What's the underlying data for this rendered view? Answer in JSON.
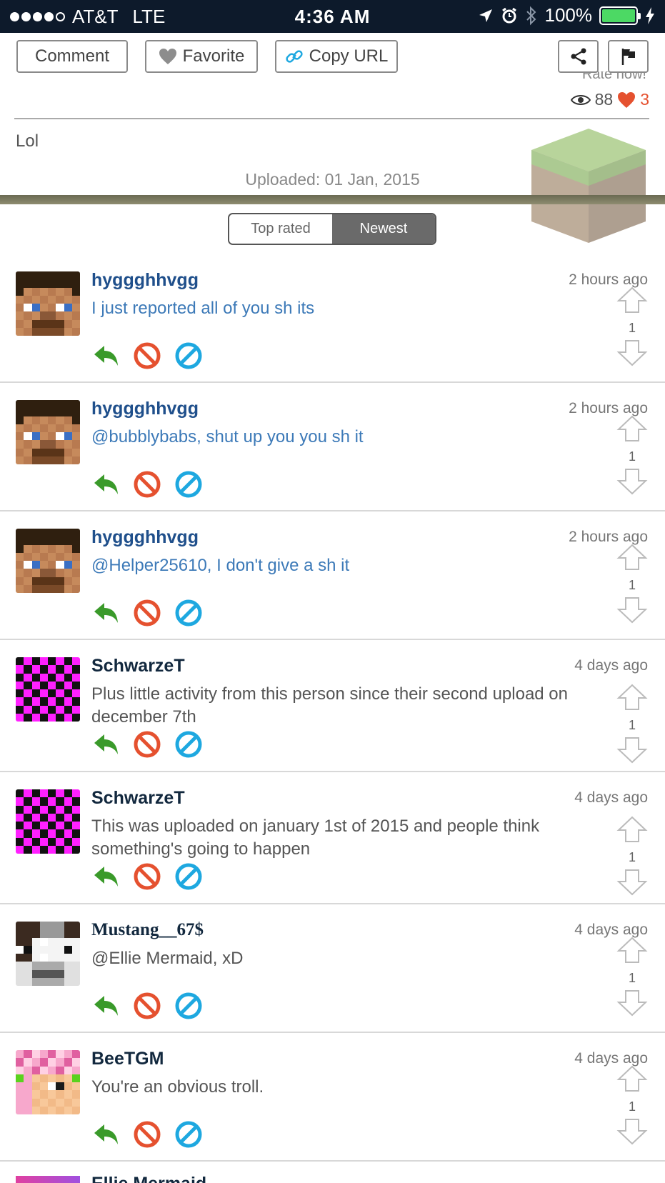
{
  "status_bar": {
    "carrier": "AT&T",
    "network": "LTE",
    "time": "4:36 AM",
    "battery": "100%"
  },
  "toolbar": {
    "comment_label": "Comment",
    "favorite_label": "Favorite",
    "copy_url_label": "Copy URL"
  },
  "meta": {
    "rate_now": "Rate now!",
    "views": "88",
    "likes": "3",
    "description": "Lol",
    "uploaded": "Uploaded: 01 Jan, 2015"
  },
  "sort": {
    "options": [
      "Top rated",
      "Newest"
    ],
    "selected": "Newest"
  },
  "colors": {
    "username_blue": "#1f4f8b",
    "comment_blue": "#3d7ab8",
    "username_dark": "#12283e",
    "comment_gray": "#555555",
    "reply_green": "#3a9a2a",
    "block_red": "#e5512f",
    "report_cyan": "#1ea8e0",
    "like_red": "#e5512f"
  },
  "comments": [
    {
      "author": "hyggghhvgg",
      "time": "2 hours ago",
      "text": "I just reported all of you sh its",
      "votes": "1",
      "avatar": "steve-avatar",
      "style": "blue"
    },
    {
      "author": "hyggghhvgg",
      "time": "2 hours ago",
      "text": "@bubblybabs, shut up you you sh it",
      "votes": "1",
      "avatar": "steve-avatar",
      "style": "blue"
    },
    {
      "author": "hyggghhvgg",
      "time": "2 hours ago",
      "text": "@Helper25610, I don't give a sh it",
      "votes": "1",
      "avatar": "steve-avatar",
      "style": "blue"
    },
    {
      "author": "SchwarzeT",
      "time": "4 days ago",
      "text": "Plus little activity from this person since their second upload on december 7th",
      "votes": "1",
      "avatar": "checker-avatar",
      "style": "gray"
    },
    {
      "author": "SchwarzeT",
      "time": "4 days ago",
      "text": "This was uploaded on january 1st of 2015 and people think something's going to happen",
      "votes": "1",
      "avatar": "checker-avatar",
      "style": "gray"
    },
    {
      "author": "Mustang__67$",
      "time": "4 days ago",
      "text": "@Ellie Mermaid, xD",
      "votes": "1",
      "avatar": "cow-avatar",
      "style": "gray"
    },
    {
      "author": "BeeTGM",
      "time": "4 days ago",
      "text": "You're an obvious troll.",
      "votes": "1",
      "avatar": "pink-avatar",
      "style": "gray"
    }
  ],
  "partial_next_author": "Ellie Mermaid"
}
